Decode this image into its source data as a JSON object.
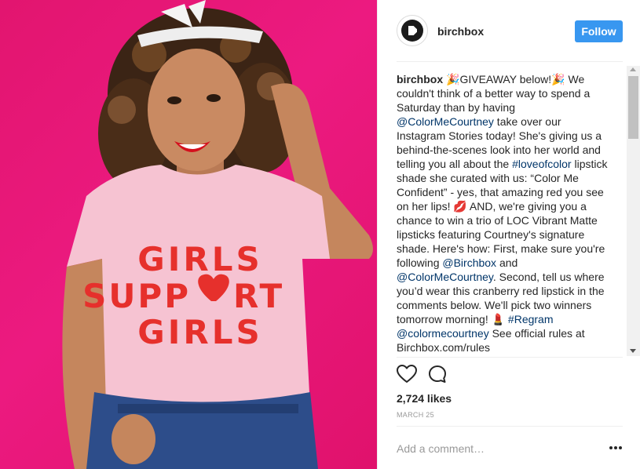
{
  "post": {
    "image_alt": "Woman in pink GIRLS SUPPORT GIRLS t-shirt on a pink background",
    "shirt_text": [
      "GIRLS",
      "SUPP",
      "RT",
      "GIRLS"
    ],
    "background_color": "#e8177a"
  },
  "header": {
    "username": "birchbox",
    "follow_label": "Follow",
    "follow_color": "#3897f0"
  },
  "caption": {
    "author": "birchbox",
    "t1": " 🎉GIVEAWAY below!🎉 We couldn't think of a better way to spend a Saturday than by having ",
    "m1": "@ColorMeCourtney",
    "t2": " take over our Instagram Stories today! She's giving us a behind-the-scenes look into her world and telling you all about the ",
    "h1": "#loveofcolor",
    "t3": " lipstick shade she curated with us: “Color Me Confident” - yes, that amazing red you see on her lips! 💋 AND, we're giving you a chance to win a trio of LOC Vibrant Matte lipsticks featuring Courtney's signature shade. Here's how: First, make sure you're following ",
    "m2": "@Birchbox",
    "t4": " and ",
    "m3": "@ColorMeCourtney",
    "t5": ". Second, tell us where you’d wear this cranberry red lipstick in the comments below. We'll pick two winners tomorrow morning! 💄 ",
    "h2": "#Regram",
    "t6": " ",
    "m4": "@colormecourtney",
    "t7": " See official rules at Birchbox.com/rules"
  },
  "actions": {
    "like_icon": "heart-icon",
    "comment_icon": "comment-icon"
  },
  "likes": "2,724 likes",
  "date": "MARCH 25",
  "comment_box": {
    "placeholder": "Add a comment…",
    "more_icon": "more-options-icon"
  },
  "colors": {
    "link": "#003569",
    "text": "#262626",
    "muted": "#999999"
  }
}
